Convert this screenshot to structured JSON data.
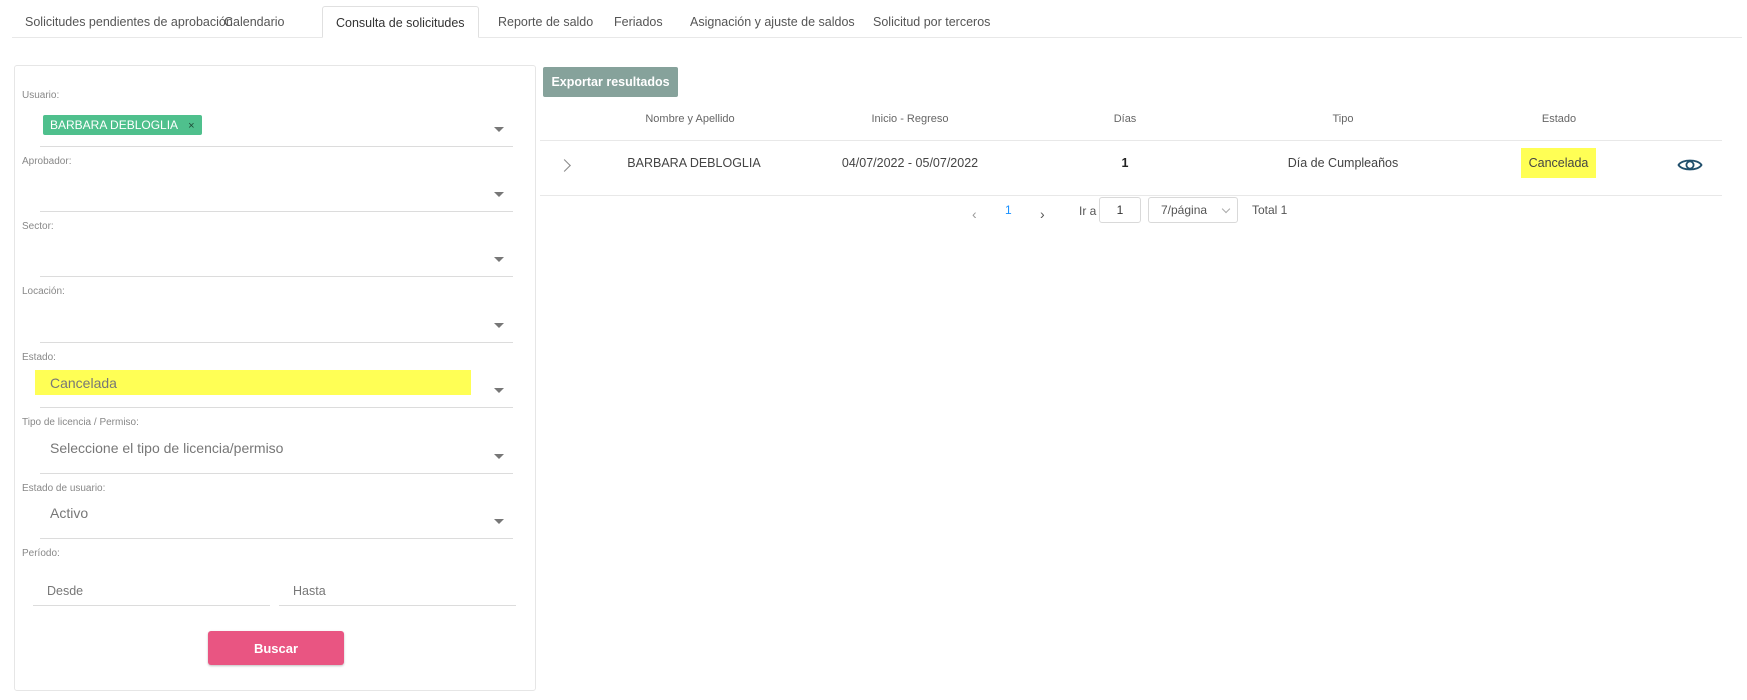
{
  "tabs": [
    {
      "label": "Solicitudes pendientes de aprobación"
    },
    {
      "label": "Calendario"
    },
    {
      "label": "Consulta de solicitudes"
    },
    {
      "label": "Reporte de saldo"
    },
    {
      "label": "Feriados"
    },
    {
      "label": "Asignación y ajuste de saldos"
    },
    {
      "label": "Solicitud por terceros"
    }
  ],
  "active_tab": "Consulta de solicitudes",
  "filters": {
    "usuario": {
      "label": "Usuario:",
      "chip": "BARBARA DEBLOGLIA",
      "chip_remove": "×"
    },
    "aprobador": {
      "label": "Aprobador:",
      "value": ""
    },
    "sector": {
      "label": "Sector:",
      "value": ""
    },
    "locacion": {
      "label": "Locación:",
      "value": ""
    },
    "estado": {
      "label": "Estado:",
      "value": "Cancelada",
      "highlight_color": "#ffff55"
    },
    "tipo": {
      "label": "Tipo de licencia / Permiso:",
      "placeholder": "Seleccione el tipo de licencia/permiso"
    },
    "estado_usuario": {
      "label": "Estado de usuario:",
      "value": "Activo"
    },
    "periodo": {
      "label": "Período:",
      "desde_placeholder": "Desde",
      "hasta_placeholder": "Hasta"
    },
    "buscar_label": "Buscar"
  },
  "results": {
    "export_label": "Exportar resultados",
    "columns": [
      "Nombre y Apellido",
      "Inicio - Regreso",
      "Días",
      "Tipo",
      "Estado"
    ],
    "rows": [
      {
        "nombre": "BARBARA DEBLOGLIA",
        "fechas": "04/07/2022 - 05/07/2022",
        "dias": "1",
        "tipo": "Día de Cumpleaños",
        "estado": "Cancelada"
      }
    ]
  },
  "pagination": {
    "current_page": "1",
    "goto_label": "Ir a",
    "goto_value": "1",
    "page_size": "7/página",
    "total": "Total 1"
  },
  "colors": {
    "primary_button": "#e95582",
    "export_button": "#86a29b",
    "chip": "#4fc08d",
    "highlight": "#ffff55",
    "link": "#1890ff"
  },
  "icons": [
    "expand-row-icon",
    "eye-icon",
    "chevron-left-icon",
    "chevron-right-icon",
    "dropdown-caret-icon",
    "chip-close-icon"
  ]
}
